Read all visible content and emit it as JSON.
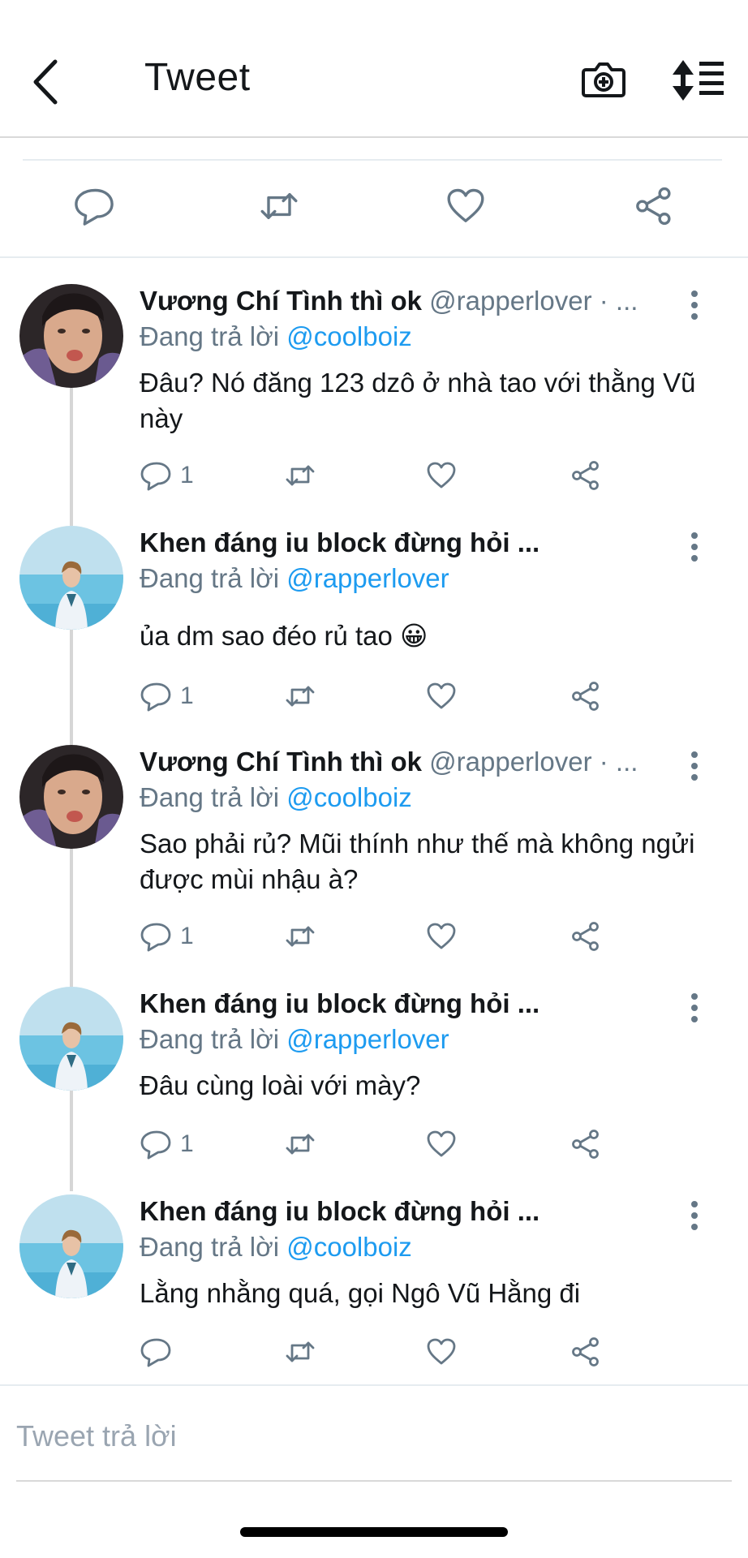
{
  "header": {
    "title": "Tweet",
    "back_icon": "chevron-left-icon",
    "camera_icon": "camera-plus-icon",
    "sort_icon": "sort-arrows-list-icon"
  },
  "main_actions": [
    "reply-icon",
    "retweet-icon",
    "like-icon",
    "share-icon"
  ],
  "replies": [
    {
      "name": "Vương Chí Tình thì ok",
      "handle": "@rapperlover · ...",
      "replying_prefix": "Đang trả lời",
      "replying_to": "@coolboiz",
      "text": "Đâu? Nó đăng 123 dzô ở nhà tao với thằng Vũ này",
      "reply_count": "1"
    },
    {
      "name": "Khen đáng iu block đừng hỏi ...",
      "handle": "",
      "replying_prefix": "Đang trả lời",
      "replying_to": "@rapperlover",
      "text": "ủa dm sao đéo rủ tao 😀",
      "reply_count": "1"
    },
    {
      "name": "Vương Chí Tình thì ok",
      "handle": "@rapperlover · ...",
      "replying_prefix": "Đang trả lời",
      "replying_to": "@coolboiz",
      "text": "Sao phải rủ? Mũi thính như thế mà không ngửi được mùi nhậu à?",
      "reply_count": "1"
    },
    {
      "name": "Khen đáng iu block đừng hỏi ...",
      "handle": "",
      "replying_prefix": "Đang trả lời",
      "replying_to": "@rapperlover",
      "text": "Đâu cùng loài với mày?",
      "reply_count": "1"
    },
    {
      "name": "Khen đáng iu block đừng hỏi ...",
      "handle": "",
      "replying_prefix": "Đang trả lời",
      "replying_to": "@coolboiz",
      "text": "Lằng nhằng quá, gọi Ngô Vũ Hằng đi",
      "reply_count": ""
    }
  ],
  "compose": {
    "placeholder": "Tweet trả lời"
  },
  "colors": {
    "link": "#1d9bf0",
    "secondary_text": "#657786",
    "icon": "#657786",
    "divider": "#e6ecf0"
  }
}
